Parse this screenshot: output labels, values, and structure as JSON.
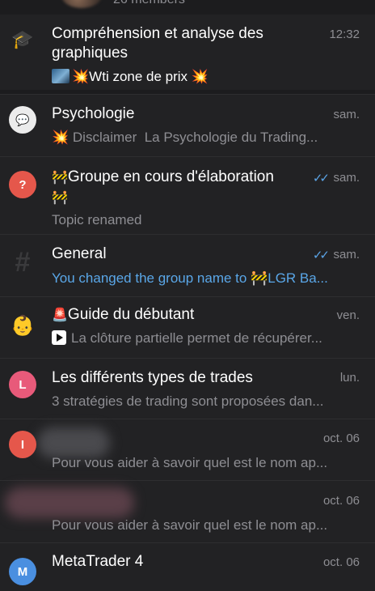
{
  "header": {
    "members_label": "26 members"
  },
  "chats": [
    {
      "title": "Compréhension et analyse des graphiques",
      "time": "12:32",
      "preview": "Wti zone de prix"
    },
    {
      "title": "Psychologie",
      "time": "sam.",
      "preview_prefix": "Disclaimer",
      "preview": "La Psychologie du Trading..."
    },
    {
      "title": "Groupe en cours d'élaboration",
      "time": "sam.",
      "preview": "Topic renamed"
    },
    {
      "title": "General",
      "time": "sam.",
      "preview": "You changed the group name to 🚧LGR Ba..."
    },
    {
      "title": "Guide du débutant",
      "time": "ven.",
      "preview": "La clôture partielle permet de récupérer..."
    },
    {
      "title": "Les différents types de trades",
      "avatar_letter": "L",
      "time": "lun.",
      "preview": "3 stratégies de trading sont proposées dan..."
    },
    {
      "avatar_letter": "I",
      "time": "oct. 06",
      "preview": "Pour vous aider à savoir quel est le nom ap..."
    },
    {
      "time": "oct. 06",
      "preview": "Pour vous aider à savoir quel est le nom ap..."
    },
    {
      "title": "MetaTrader 4",
      "avatar_letter": "M",
      "time": "oct. 06"
    }
  ],
  "colors": {
    "background": "#1c1c1e",
    "row": "#222224",
    "accent_blue": "#5aa7e8",
    "avatar_red": "#e5574b",
    "avatar_pink": "#e85a7a",
    "avatar_blue": "#4a8fe0"
  },
  "icons": [
    "graduation-cap-icon",
    "speech-bubble-icon",
    "help-bubble-icon",
    "hashtag-icon",
    "baby-face-icon",
    "construction-icon",
    "siren-icon",
    "explosion-icon",
    "double-check-icon",
    "play-icon"
  ]
}
